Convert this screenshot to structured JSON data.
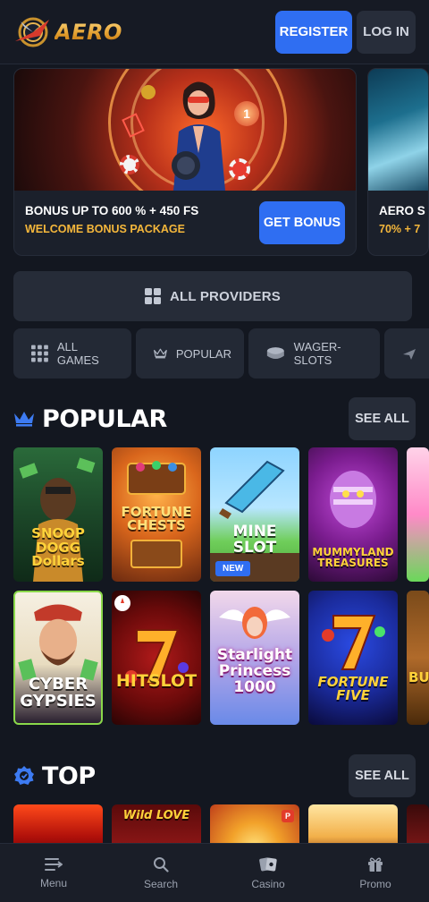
{
  "header": {
    "logo_text": "AERO",
    "register_label": "REGISTER",
    "login_label": "LOG IN"
  },
  "promos": [
    {
      "title": "BONUS UP TO 600 % + 450 FS",
      "subtitle": "WELCOME BONUS PACKAGE",
      "button": "GET BONUS"
    },
    {
      "title": "AERO S",
      "subtitle": "70% + 7"
    }
  ],
  "providers": {
    "label": "ALL PROVIDERS",
    "icon": "grid-icon"
  },
  "categories": [
    {
      "label": "ALL GAMES",
      "icon": "dots-grid-icon"
    },
    {
      "label": "POPULAR",
      "icon": "crown-icon"
    },
    {
      "label": "WAGER-SLOTS",
      "icon": "coins-icon"
    },
    {
      "label": "",
      "icon": "plane-icon"
    }
  ],
  "popular": {
    "title": "POPULAR",
    "see_all": "SEE ALL",
    "row1": [
      {
        "label": "SNOOP DOGG Dollars",
        "badge": ""
      },
      {
        "label": "FORTUNE CHESTS",
        "badge": ""
      },
      {
        "label": "MINE SLOT",
        "badge": "NEW"
      },
      {
        "label": "MUMMYLAND TREASURES",
        "badge": ""
      },
      {
        "label": "",
        "badge": ""
      }
    ],
    "row2": [
      {
        "label": "CYBER GYPSIES"
      },
      {
        "label": "HITSLOT"
      },
      {
        "label": "Starlight Princess 1000"
      },
      {
        "label": "FORTUNE FIVE"
      },
      {
        "label": "BU"
      }
    ]
  },
  "top": {
    "title": "TOP",
    "see_all": "SEE ALL",
    "row": [
      {
        "label": ""
      },
      {
        "label": "Wild LOVE"
      },
      {
        "label": ""
      },
      {
        "label": ""
      },
      {
        "label": ""
      }
    ]
  },
  "bottom_nav": [
    {
      "label": "Menu",
      "icon": "menu-icon"
    },
    {
      "label": "Search",
      "icon": "search-icon"
    },
    {
      "label": "Casino",
      "icon": "cards-icon"
    },
    {
      "label": "Promo",
      "icon": "gift-icon"
    }
  ],
  "colors": {
    "background": "#131720",
    "accent_blue": "#2f6ef2",
    "gold": "#f5b73b",
    "card": "#262c38"
  }
}
